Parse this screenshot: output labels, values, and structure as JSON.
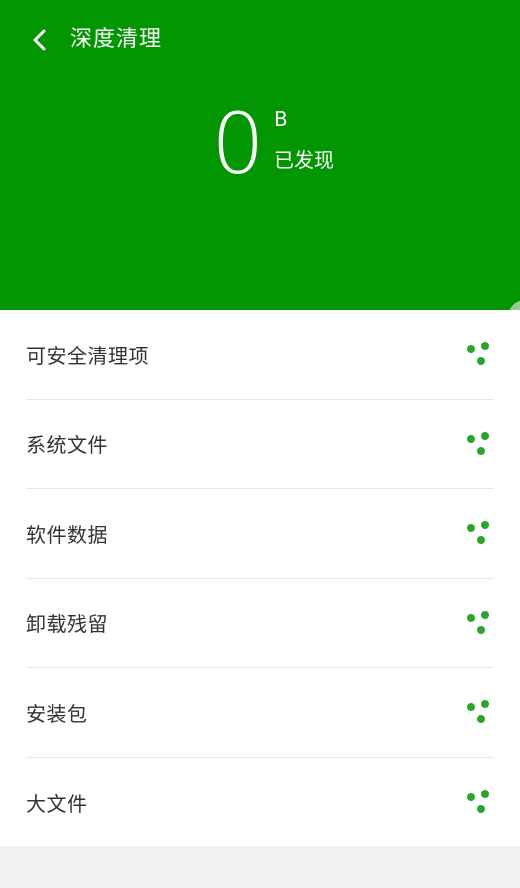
{
  "header": {
    "title": "深度清理",
    "size_value": "0",
    "size_unit": "B",
    "found_label": "已发现",
    "background_color": "#029702"
  },
  "icons": {
    "back": "chevron-left-icon",
    "item_status": "loading-dots-icon"
  },
  "accent_color": "#2aa52a",
  "items": [
    {
      "label": "可安全清理项"
    },
    {
      "label": "系统文件"
    },
    {
      "label": "软件数据"
    },
    {
      "label": "卸载残留"
    },
    {
      "label": "安装包"
    },
    {
      "label": "大文件"
    }
  ]
}
